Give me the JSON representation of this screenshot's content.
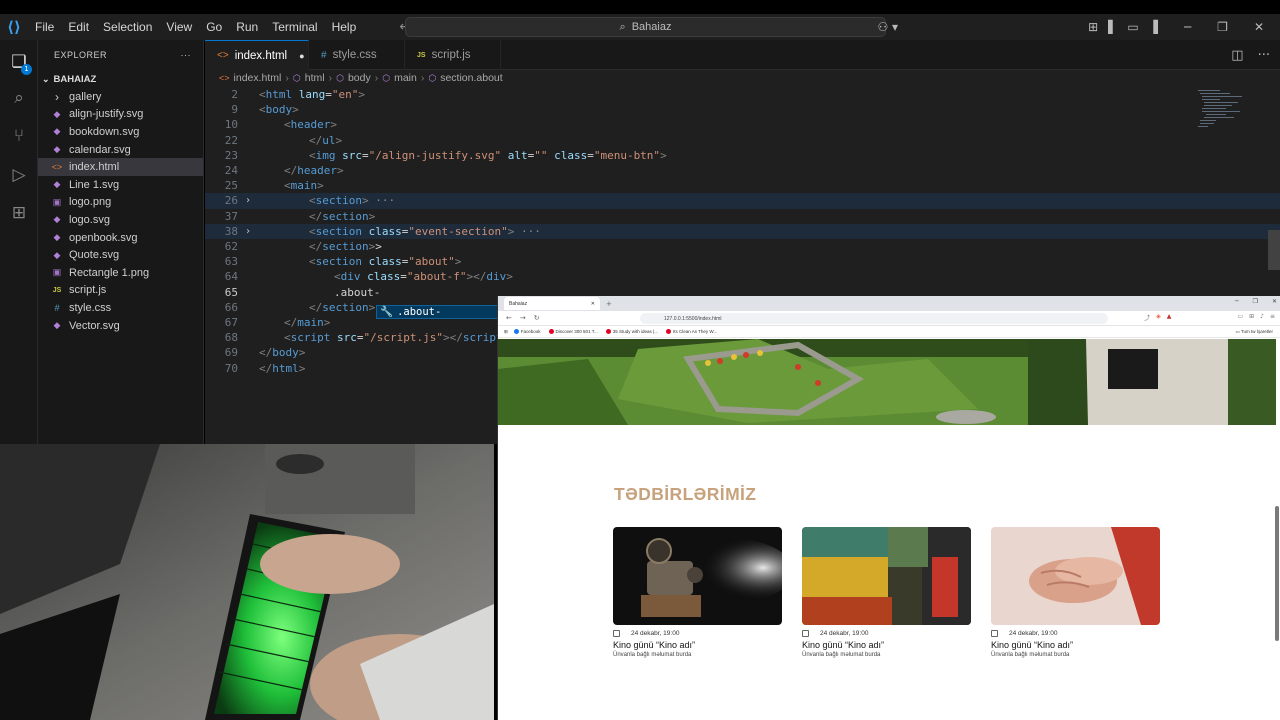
{
  "titlebar": {
    "menu": [
      "File",
      "Edit",
      "Selection",
      "View",
      "Go",
      "Run",
      "Terminal",
      "Help"
    ],
    "search": "Bahaiaz"
  },
  "activity": {
    "explorer_badge": "1"
  },
  "explorer": {
    "header": "EXPLORER",
    "folder": "BAHAIAZ",
    "items": [
      {
        "label": "gallery",
        "type": "folder"
      },
      {
        "label": "align-justify.svg",
        "type": "svg"
      },
      {
        "label": "bookdown.svg",
        "type": "svg"
      },
      {
        "label": "calendar.svg",
        "type": "svg"
      },
      {
        "label": "index.html",
        "type": "html",
        "selected": true
      },
      {
        "label": "Line 1.svg",
        "type": "svg"
      },
      {
        "label": "logo.png",
        "type": "png"
      },
      {
        "label": "logo.svg",
        "type": "svg"
      },
      {
        "label": "openbook.svg",
        "type": "svg"
      },
      {
        "label": "Quote.svg",
        "type": "svg"
      },
      {
        "label": "Rectangle 1.png",
        "type": "png"
      },
      {
        "label": "script.js",
        "type": "js"
      },
      {
        "label": "style.css",
        "type": "css"
      },
      {
        "label": "Vector.svg",
        "type": "svg"
      }
    ]
  },
  "tabs": [
    {
      "label": "index.html",
      "icon": "<>",
      "active": true,
      "modified": true
    },
    {
      "label": "style.css",
      "icon": "#"
    },
    {
      "label": "script.js",
      "icon": "JS"
    }
  ],
  "breadcrumb": [
    "index.html",
    "html",
    "body",
    "main",
    "section.about"
  ],
  "editor": {
    "lines": [
      {
        "n": "2",
        "indent": 0,
        "parts": [
          [
            "t",
            "<"
          ],
          [
            "tn",
            "html"
          ],
          [
            "tx",
            " "
          ],
          [
            "an",
            "lang"
          ],
          [
            "tx",
            "="
          ],
          [
            "av",
            "\"en\""
          ],
          [
            "t",
            ">"
          ]
        ]
      },
      {
        "n": "9",
        "indent": 0,
        "parts": [
          [
            "t",
            "<"
          ],
          [
            "tn",
            "body"
          ],
          [
            "t",
            ">"
          ]
        ]
      },
      {
        "n": "10",
        "indent": 1,
        "parts": [
          [
            "t",
            "<"
          ],
          [
            "tn",
            "header"
          ],
          [
            "t",
            ">"
          ]
        ]
      },
      {
        "n": "22",
        "indent": 2,
        "parts": [
          [
            "t",
            "</"
          ],
          [
            "tn",
            "ul"
          ],
          [
            "t",
            ">"
          ]
        ]
      },
      {
        "n": "23",
        "indent": 2,
        "parts": [
          [
            "t",
            "<"
          ],
          [
            "tn",
            "img"
          ],
          [
            "tx",
            " "
          ],
          [
            "an",
            "src"
          ],
          [
            "tx",
            "="
          ],
          [
            "av",
            "\"/align-justify.svg\""
          ],
          [
            "tx",
            " "
          ],
          [
            "an",
            "alt"
          ],
          [
            "tx",
            "="
          ],
          [
            "av",
            "\"\""
          ],
          [
            "tx",
            " "
          ],
          [
            "an",
            "class"
          ],
          [
            "tx",
            "="
          ],
          [
            "av",
            "\"menu-btn\""
          ],
          [
            "t",
            ">"
          ]
        ]
      },
      {
        "n": "24",
        "indent": 1,
        "parts": [
          [
            "t",
            "</"
          ],
          [
            "tn",
            "header"
          ],
          [
            "t",
            ">"
          ]
        ]
      },
      {
        "n": "25",
        "indent": 1,
        "parts": [
          [
            "t",
            "<"
          ],
          [
            "tn",
            "main"
          ],
          [
            "t",
            ">"
          ]
        ]
      },
      {
        "n": "26",
        "indent": 2,
        "fold": true,
        "hl": true,
        "parts": [
          [
            "t",
            "<"
          ],
          [
            "tn",
            "section"
          ],
          [
            "t",
            ">"
          ],
          [
            "ell",
            " ···"
          ]
        ]
      },
      {
        "n": "37",
        "indent": 2,
        "parts": [
          [
            "t",
            "</"
          ],
          [
            "tn",
            "section"
          ],
          [
            "t",
            ">"
          ]
        ]
      },
      {
        "n": "38",
        "indent": 2,
        "fold": true,
        "hl": true,
        "parts": [
          [
            "t",
            "<"
          ],
          [
            "tn",
            "section"
          ],
          [
            "tx",
            " "
          ],
          [
            "an",
            "class"
          ],
          [
            "tx",
            "="
          ],
          [
            "av",
            "\"event-section\""
          ],
          [
            "t",
            ">"
          ],
          [
            "ell",
            " ···"
          ]
        ]
      },
      {
        "n": "62",
        "indent": 2,
        "parts": [
          [
            "t",
            "</"
          ],
          [
            "tn",
            "section"
          ],
          [
            "t",
            ">"
          ],
          [
            "tx",
            ">"
          ]
        ]
      },
      {
        "n": "63",
        "indent": 2,
        "parts": [
          [
            "t",
            "<"
          ],
          [
            "tn",
            "section"
          ],
          [
            "tx",
            " "
          ],
          [
            "an",
            "class"
          ],
          [
            "tx",
            "="
          ],
          [
            "av",
            "\"about\""
          ],
          [
            "t",
            ">"
          ]
        ]
      },
      {
        "n": "64",
        "indent": 3,
        "parts": [
          [
            "t",
            "<"
          ],
          [
            "tn",
            "div"
          ],
          [
            "tx",
            " "
          ],
          [
            "an",
            "class"
          ],
          [
            "tx",
            "="
          ],
          [
            "av",
            "\"about-f\""
          ],
          [
            "t",
            "></"
          ],
          [
            "tn",
            "div"
          ],
          [
            "t",
            ">"
          ]
        ]
      },
      {
        "n": "65",
        "indent": 3,
        "cur": true,
        "parts": [
          [
            "tx",
            ".about-"
          ]
        ]
      },
      {
        "n": "66",
        "indent": 2,
        "parts": [
          [
            "t",
            "</"
          ],
          [
            "tn",
            "section"
          ],
          [
            "t",
            ">"
          ]
        ]
      },
      {
        "n": "67",
        "indent": 1,
        "parts": [
          [
            "t",
            "</"
          ],
          [
            "tn",
            "main"
          ],
          [
            "t",
            ">"
          ]
        ]
      },
      {
        "n": "68",
        "indent": 1,
        "parts": [
          [
            "t",
            "<"
          ],
          [
            "tn",
            "script"
          ],
          [
            "tx",
            " "
          ],
          [
            "an",
            "src"
          ],
          [
            "tx",
            "="
          ],
          [
            "av",
            "\"/script.js\""
          ],
          [
            "t",
            "></"
          ],
          [
            "tn",
            "script"
          ],
          [
            "t",
            ">"
          ]
        ]
      },
      {
        "n": "69",
        "indent": 0,
        "parts": [
          [
            "t",
            "</"
          ],
          [
            "tn",
            "body"
          ],
          [
            "t",
            ">"
          ]
        ]
      },
      {
        "n": "70",
        "indent": 0,
        "parts": [
          [
            "t",
            "</"
          ],
          [
            "tn",
            "html"
          ],
          [
            "t",
            ">"
          ]
        ]
      }
    ],
    "suggestion": ".about-"
  },
  "browser": {
    "tab_title": "Bahaiaz",
    "url": "127.0.0.1:5500/index.html",
    "bookmarks": [
      {
        "label": "Facebook",
        "color": "#1877f2"
      },
      {
        "label": "Discover 300 501 T...",
        "color": "#e60023"
      },
      {
        "label": "35 Study with ideas |...",
        "color": "#e60023"
      },
      {
        "label": "Its Clean As They W...",
        "color": "#e60023"
      }
    ],
    "all_bookmarks": "Tum tw İşaretler",
    "section_title": "TƏDBİRLƏRİMİZ",
    "cards": [
      {
        "date": "24 dekabr, 19:00",
        "title": "Kino günü “Kino adı”",
        "desc": "Ünvanla bağlı məlumat burda",
        "image": "projector"
      },
      {
        "date": "24 dekabr, 19:00",
        "title": "Kino günü “Kino adı”",
        "desc": "Ünvanla bağlı məlumat burda",
        "image": "posters"
      },
      {
        "date": "24 dekabr, 19:00",
        "title": "Kino günü “Kino adı”",
        "desc": "Ünvanla bağlı məlumat burda",
        "image": "hands"
      }
    ]
  },
  "colors": {
    "accent": "#0078d4",
    "brand_title": "#c7a27c"
  }
}
